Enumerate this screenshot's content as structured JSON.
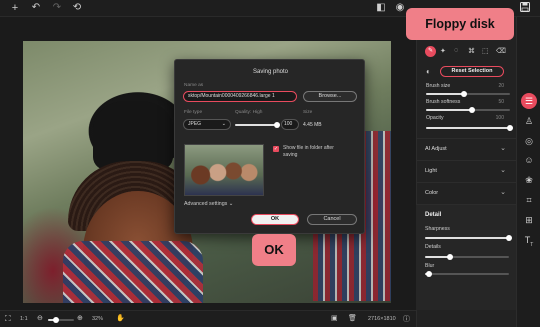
{
  "topbar": {
    "icons": [
      "plus-icon",
      "undo-icon",
      "redo-icon",
      "reset-icon",
      "compare-icon",
      "eye-icon",
      "floppy-disk-icon"
    ]
  },
  "callouts": {
    "floppy": "Floppy disk",
    "ok": "OK"
  },
  "dialog": {
    "title": "Saving photo",
    "name_label": "Name as",
    "name_value": "sktop/Mountain0000409266846.large 1",
    "browse_label": "Browse...",
    "file_type_label": "File type",
    "file_type_value": "JPEG",
    "quality_label": "Quality: High",
    "quality_level": 100,
    "quality_value": "100",
    "size_label": "Size",
    "size_value": "4.45 MB",
    "show_in_folder_label": "Show file in folder after saving",
    "show_in_folder_checked": true,
    "advanced_label": "Advanced settings",
    "ok_label": "OK",
    "cancel_label": "Cancel"
  },
  "sidebar": {
    "tool_icons": [
      "brush-icon",
      "pin-icon",
      "lasso-icon",
      "lasso-polygon-icon",
      "select-rect-icon",
      "eraser-icon"
    ],
    "reset_selection_label": "Reset Selection",
    "brush_size_label": "Brush size",
    "brush_size_value": "20",
    "brush_size_level": 0.45,
    "brush_softness_label": "Brush softness",
    "brush_softness_value": "50",
    "brush_softness_level": 0.55,
    "opacity_label": "Opacity",
    "opacity_value": "100",
    "opacity_level": 1.0,
    "sections": [
      {
        "label": "AI Adjust"
      },
      {
        "label": "Light"
      },
      {
        "label": "Color"
      }
    ],
    "detail_label": "Detail",
    "sharpness_label": "Sharpness",
    "sharpness_level": 1.0,
    "details_label": "Details",
    "details_level": 0.3,
    "blur_label": "Blur",
    "blur_level": 0.05
  },
  "rail": {
    "icons": [
      "adjust-sliders-icon",
      "stamp-icon",
      "eye-retouch-icon",
      "face-icon",
      "color-circles-icon",
      "crop-icon",
      "add-frame-icon",
      "text-icon"
    ]
  },
  "bottombar": {
    "fit_label": "1:1",
    "zoom_value": "32%",
    "zoom_level": 0.3,
    "dimensions": "2716×1810"
  },
  "colors": {
    "accent": "#e84b5e",
    "callout": "#f07f88"
  }
}
